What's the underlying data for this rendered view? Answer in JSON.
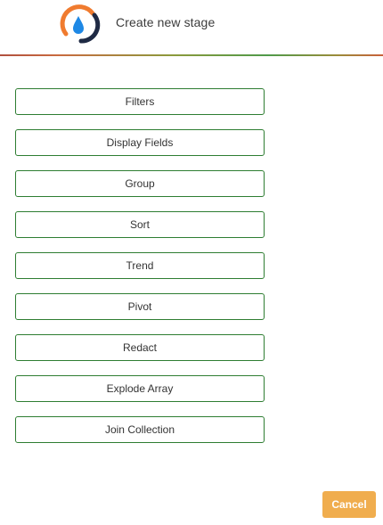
{
  "header": {
    "title": "Create new stage",
    "logo_icon": "app-logo-icon"
  },
  "stages": [
    {
      "label": "Filters"
    },
    {
      "label": "Display Fields"
    },
    {
      "label": "Group"
    },
    {
      "label": "Sort"
    },
    {
      "label": "Trend"
    },
    {
      "label": "Pivot"
    },
    {
      "label": "Redact"
    },
    {
      "label": "Explode Array"
    },
    {
      "label": "Join Collection"
    }
  ],
  "footer": {
    "cancel_label": "Cancel"
  },
  "colors": {
    "stage_border": "#2e7d32",
    "cancel_background": "#f0ad4e",
    "logo_orange": "#f07b2f",
    "logo_blue": "#1e88e5",
    "logo_dark": "#1f2a44"
  }
}
